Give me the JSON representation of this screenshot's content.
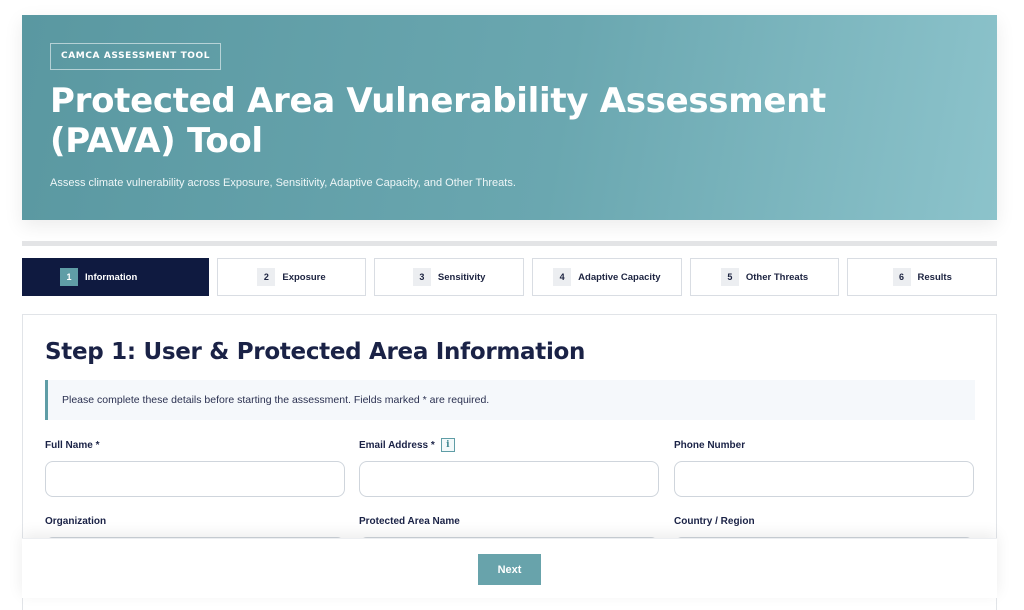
{
  "hero": {
    "badge": "CAMCA ASSESSMENT TOOL",
    "title": "Protected Area Vulnerability Assessment (PAVA) Tool",
    "subtitle": "Assess climate vulnerability across Exposure, Sensitivity, Adaptive Capacity, and Other Threats."
  },
  "steps": [
    {
      "num": "1",
      "label": "Information",
      "active": true
    },
    {
      "num": "2",
      "label": "Exposure"
    },
    {
      "num": "3",
      "label": "Sensitivity"
    },
    {
      "num": "4",
      "label": "Adaptive Capacity"
    },
    {
      "num": "5",
      "label": "Other Threats"
    },
    {
      "num": "6",
      "label": "Results"
    }
  ],
  "form": {
    "title": "Step 1: User & Protected Area Information",
    "notice": "Please complete these details before starting the assessment. Fields marked * are required.",
    "fields": {
      "full_name": {
        "label": "Full Name *",
        "value": ""
      },
      "email": {
        "label": "Email Address *",
        "value": "",
        "info_icon": "info-icon"
      },
      "phone": {
        "label": "Phone Number",
        "value": ""
      },
      "organization": {
        "label": "Organization",
        "value": ""
      },
      "protected_area": {
        "label": "Protected Area Name",
        "value": ""
      },
      "country": {
        "label": "Country / Region",
        "value": ""
      }
    }
  },
  "footer": {
    "next_label": "Next"
  },
  "colors": {
    "accent": "#5f9da6",
    "navy": "#0f1a40",
    "hero_start": "#5a98a1",
    "hero_end": "#8cc3cb"
  }
}
